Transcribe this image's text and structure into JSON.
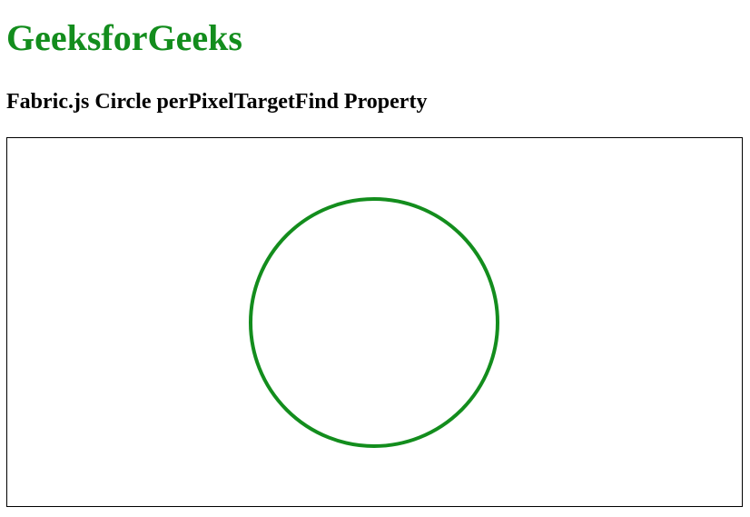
{
  "header": {
    "title": "GeeksforGeeks",
    "subtitle": "Fabric.js Circle perPixelTargetFind Property"
  },
  "colors": {
    "title": "#138d1d",
    "circle_stroke": "#138d1d",
    "circle_fill": "#ffffff",
    "canvas_border": "#000000"
  }
}
